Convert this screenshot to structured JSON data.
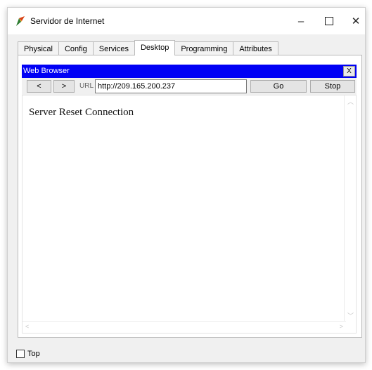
{
  "window": {
    "title": "Servidor de Internet",
    "minimize_glyph": "–",
    "close_glyph": "✕",
    "icon": "packet-tracer-server-icon"
  },
  "tabs": [
    {
      "label": "Physical"
    },
    {
      "label": "Config"
    },
    {
      "label": "Services"
    },
    {
      "label": "Desktop",
      "active": true
    },
    {
      "label": "Programming"
    },
    {
      "label": "Attributes"
    }
  ],
  "web_browser": {
    "title": "Web Browser",
    "close_label": "X",
    "back_label": "<",
    "forward_label": ">",
    "url_label": "URL",
    "url_value": "http://209.165.200.237",
    "go_label": "Go",
    "stop_label": "Stop",
    "page_text": "Server Reset Connection"
  },
  "footer": {
    "top_checkbox_label": "Top",
    "top_checked": false
  },
  "colors": {
    "browser_title_bg": "#0000f5",
    "window_bg": "#f0f0f0"
  }
}
